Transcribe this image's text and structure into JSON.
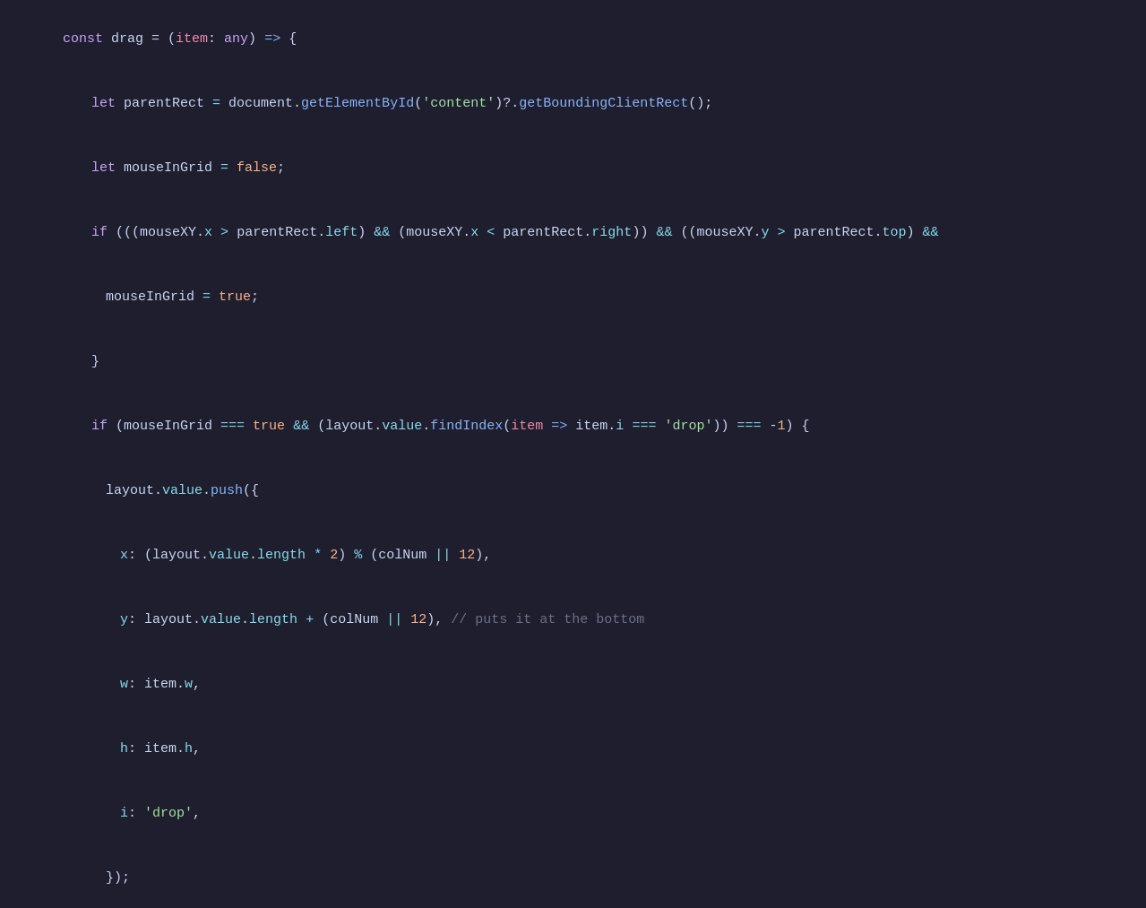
{
  "editor": {
    "background": "#1e1e2e",
    "lines": []
  },
  "colors": {
    "keyword": "#cba6f7",
    "function": "#89b4fa",
    "string_green": "#a6e3a1",
    "string_orange": "#fab387",
    "number": "#fab387",
    "comment": "#6c7086",
    "cyan": "#94e2d5",
    "yellow": "#f9e2af",
    "pink": "#f38ba8",
    "text": "#cdd6f4"
  }
}
